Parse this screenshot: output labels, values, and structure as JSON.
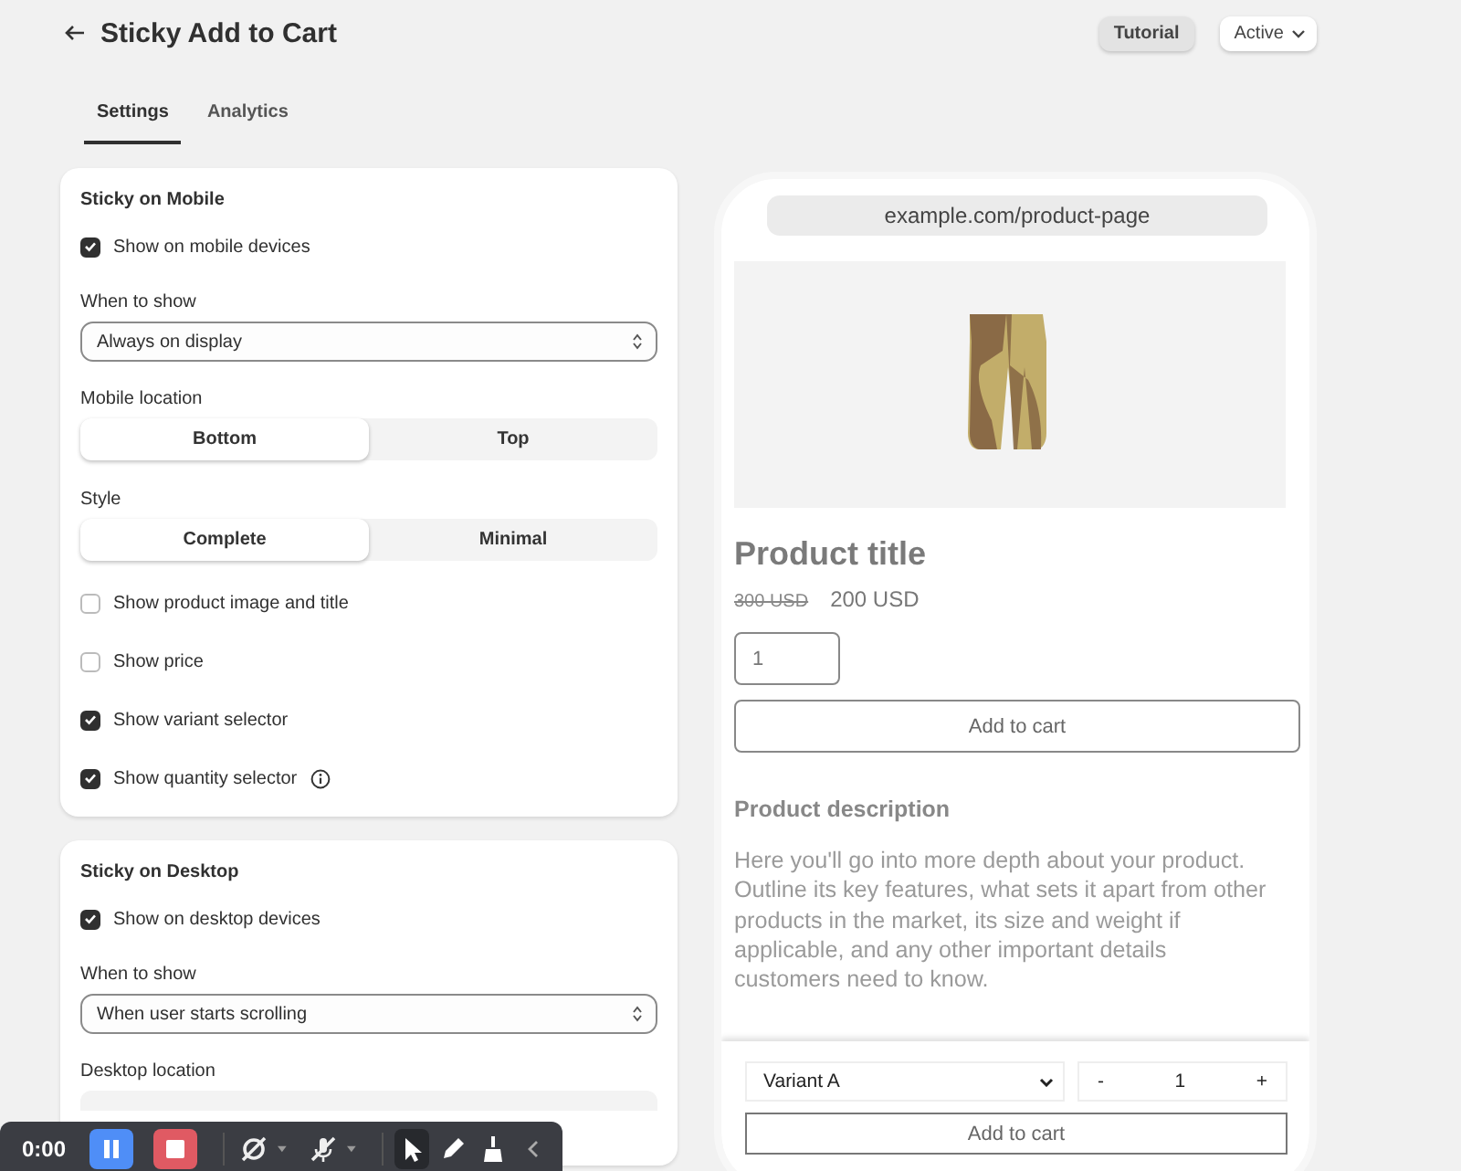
{
  "header": {
    "title": "Sticky Add to Cart",
    "tutorial": "Tutorial",
    "status": "Active"
  },
  "tabs": [
    {
      "label": "Settings",
      "selected": true
    },
    {
      "label": "Analytics",
      "selected": false
    }
  ],
  "cards": [
    {
      "title": "Sticky on Mobile",
      "items": [
        {
          "kind": "checkbox",
          "label": "Show on mobile devices",
          "checked": true
        },
        {
          "kind": "select",
          "label": "When to show",
          "value": "Always on display"
        },
        {
          "kind": "segmented",
          "label": "Mobile location",
          "options": [
            {
              "label": "Bottom",
              "selected": true
            },
            {
              "label": "Top",
              "selected": false
            }
          ]
        },
        {
          "kind": "segmented",
          "label": "Style",
          "options": [
            {
              "label": "Complete",
              "selected": true
            },
            {
              "label": "Minimal",
              "selected": false
            }
          ]
        },
        {
          "kind": "checkbox",
          "label": "Show product image and title",
          "checked": false
        },
        {
          "kind": "checkbox",
          "label": "Show price",
          "checked": false
        },
        {
          "kind": "checkbox",
          "label": "Show variant selector",
          "checked": true
        },
        {
          "kind": "checkbox",
          "label": "Show quantity selector",
          "checked": true,
          "info": true
        }
      ]
    },
    {
      "title": "Sticky on Desktop",
      "items": [
        {
          "kind": "checkbox",
          "label": "Show on desktop devices",
          "checked": true
        },
        {
          "kind": "select",
          "label": "When to show",
          "value": "When user starts scrolling"
        },
        {
          "kind": "segmented",
          "label": "Desktop location"
        }
      ]
    }
  ],
  "preview": {
    "url": "example.com/product-page",
    "product_title": "Product title",
    "old_price": "300 USD",
    "price": "200 USD",
    "quantity": "1",
    "add_to_cart": "Add to cart",
    "description_title": "Product description",
    "description": "Here you'll go into more depth about your product. Outline its key features, what sets it apart from other products in the market, its size and weight if applicable, and any other important details customers need to know.",
    "sticky_bar": {
      "variant": "Variant A",
      "minus": "-",
      "quantity": "1",
      "plus": "+",
      "add_to_cart": "Add to cart"
    }
  },
  "recorder": {
    "time": "0:00",
    "tools": [
      {
        "kind": "pause",
        "selected": false
      },
      {
        "kind": "stop",
        "selected": false
      },
      {
        "kind": "camera-off",
        "selected": false,
        "menu": true
      },
      {
        "kind": "mic-off",
        "selected": false,
        "menu": true
      },
      {
        "kind": "pointer",
        "selected": true
      },
      {
        "kind": "pen",
        "selected": false
      },
      {
        "kind": "broom",
        "selected": false
      },
      {
        "kind": "collapse",
        "selected": false
      }
    ]
  }
}
